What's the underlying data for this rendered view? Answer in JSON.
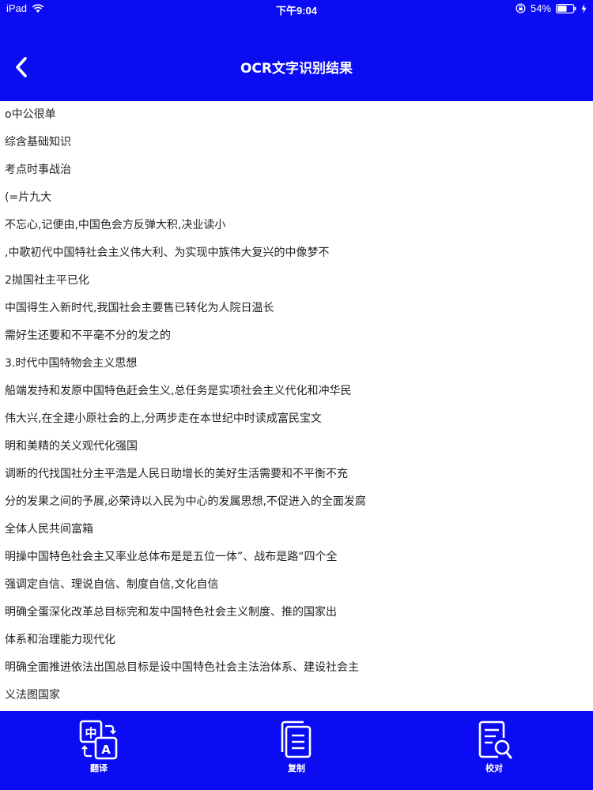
{
  "status_bar": {
    "device": "iPad",
    "time": "下午9:04",
    "battery": "54%"
  },
  "nav": {
    "title": "OCR文字识别结果",
    "back_icon": "chevron-left-icon"
  },
  "colors": {
    "header_bg": "#0b0cf2",
    "toolbar_bg": "#0b0cf2",
    "text": "#222222"
  },
  "ocr_lines": [
    "o中公很单",
    "综含基础知识",
    "考点时事战治",
    "(=片九大",
    "不忘心,记便由,中国色会方反弹大积,决业读小",
    ",中歌初代中国特社会主义伟大利、为实现中族伟大复兴的中像梦不",
    "2抛国社主平已化",
    "中国得生入新时代,我国社会主要售已转化为人院日温长",
    "需好生还要和不平毫不分的发之的",
    "3.时代中国特物会主义思想",
    "船端发持和发原中国特色赶会生义,总任务是实项社会主义代化和冲华民",
    "伟大兴,在全建小原社会的上,分两步走在本世纪中时读成富民宝文",
    "明和美精的关义观代化强国",
    "调断的代找国社分主平浩是人民日助增长的美好生活需要和不平衡不充",
    "分的发果之间的予展,必荣诗以入民为中心的发属思想,不促进入的全面发腐",
    "全体人民共间富箱",
    "明操中国特色社会主又率业总体布是是五位一体”、战布是路“四个全",
    "强调定自信、理说自信、制度自信,文化自信",
    "明确全蛋深化改革总目标完和发中国特色社会主义制度、推的国家出",
    "体系和治理能力现代化",
    "明确全面推进依法出国总目标是设中国特色社会主法治体系、建设社会主",
    "义法图国家"
  ],
  "toolbar": {
    "translate": {
      "label": "翻译",
      "icon": "translate-icon",
      "glyph_zh": "中",
      "glyph_a": "A"
    },
    "copy": {
      "label": "复制",
      "icon": "copy-icon"
    },
    "proofread": {
      "label": "校对",
      "icon": "proofread-icon"
    }
  }
}
